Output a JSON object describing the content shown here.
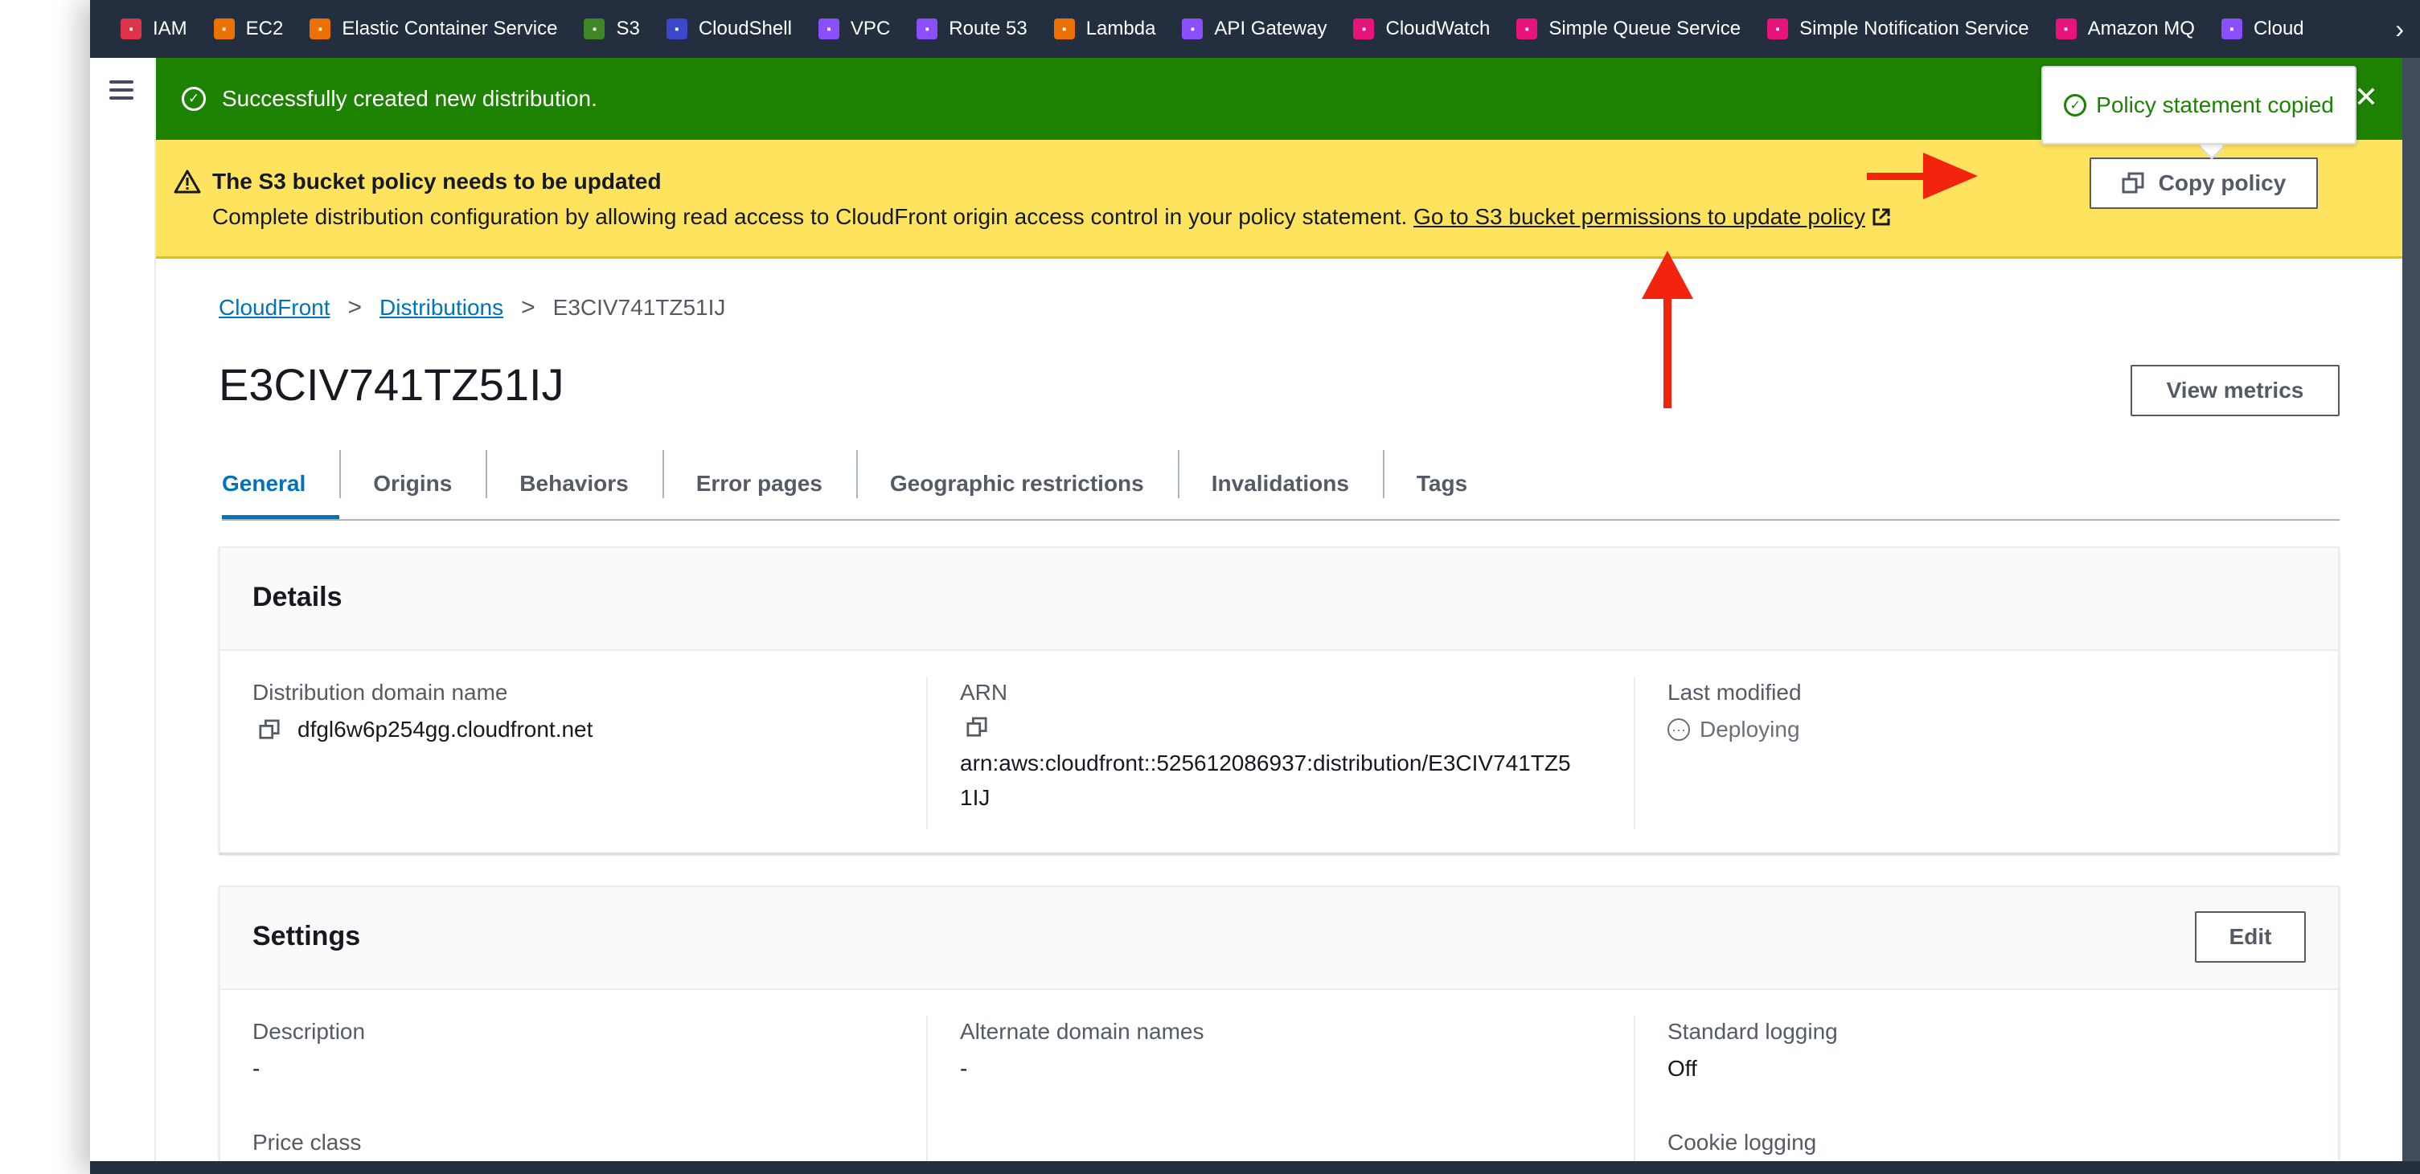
{
  "service_bar": {
    "items": [
      {
        "label": "IAM",
        "icon": "iam-icon",
        "color": "#dd344c"
      },
      {
        "label": "EC2",
        "icon": "ec2-icon",
        "color": "#ed7100"
      },
      {
        "label": "Elastic Container Service",
        "icon": "ecs-icon",
        "color": "#ed7100"
      },
      {
        "label": "S3",
        "icon": "s3-icon",
        "color": "#3f8624"
      },
      {
        "label": "CloudShell",
        "icon": "cloudshell-icon",
        "color": "#3b48cc"
      },
      {
        "label": "VPC",
        "icon": "vpc-icon",
        "color": "#8c4fff"
      },
      {
        "label": "Route 53",
        "icon": "route53-icon",
        "color": "#8c4fff"
      },
      {
        "label": "Lambda",
        "icon": "lambda-icon",
        "color": "#ed7100"
      },
      {
        "label": "API Gateway",
        "icon": "api-gateway-icon",
        "color": "#8c4fff"
      },
      {
        "label": "CloudWatch",
        "icon": "cloudwatch-icon",
        "color": "#e7157b"
      },
      {
        "label": "Simple Queue Service",
        "icon": "sqs-icon",
        "color": "#e7157b"
      },
      {
        "label": "Simple Notification Service",
        "icon": "sns-icon",
        "color": "#e7157b"
      },
      {
        "label": "Amazon MQ",
        "icon": "amazon-mq-icon",
        "color": "#e7157b"
      },
      {
        "label": "Cloud",
        "icon": "cloudfront-icon",
        "color": "#8c4fff"
      }
    ]
  },
  "success_banner": {
    "message": "Successfully created new distribution."
  },
  "warning_banner": {
    "title": "The S3 bucket policy needs to be updated",
    "body": "Complete distribution configuration by allowing read access to CloudFront origin access control in your policy statement.",
    "link": "Go to S3 bucket permissions to update policy",
    "copy_button": "Copy policy"
  },
  "popover": {
    "text": "Policy statement copied"
  },
  "breadcrumb": {
    "items": [
      "CloudFront",
      "Distributions"
    ],
    "current": "E3CIV741TZ51IJ"
  },
  "page": {
    "title": "E3CIV741TZ51IJ",
    "view_metrics": "View metrics"
  },
  "tabs": [
    {
      "label": "General",
      "active": true
    },
    {
      "label": "Origins"
    },
    {
      "label": "Behaviors"
    },
    {
      "label": "Error pages"
    },
    {
      "label": "Geographic restrictions"
    },
    {
      "label": "Invalidations"
    },
    {
      "label": "Tags"
    }
  ],
  "details": {
    "title": "Details",
    "domain_label": "Distribution domain name",
    "domain_value": "dfgl6w6p254gg.cloudfront.net",
    "arn_label": "ARN",
    "arn_line1": "arn:aws:cloudfront::525612086937:distribution/E3CIV741TZ5",
    "arn_line2": "1IJ",
    "modified_label": "Last modified",
    "modified_value": "Deploying"
  },
  "settings": {
    "title": "Settings",
    "edit": "Edit",
    "description_label": "Description",
    "description_value": "-",
    "alt_domains_label": "Alternate domain names",
    "alt_domains_value": "-",
    "std_logging_label": "Standard logging",
    "std_logging_value": "Off",
    "price_class_label": "Price class",
    "cookie_logging_label": "Cookie logging"
  },
  "colors": {
    "success": "#1d8102",
    "warning": "#fee35e",
    "link": "#0073bb",
    "annotation_arrow": "#f2240e",
    "nav": "#232f3e"
  }
}
